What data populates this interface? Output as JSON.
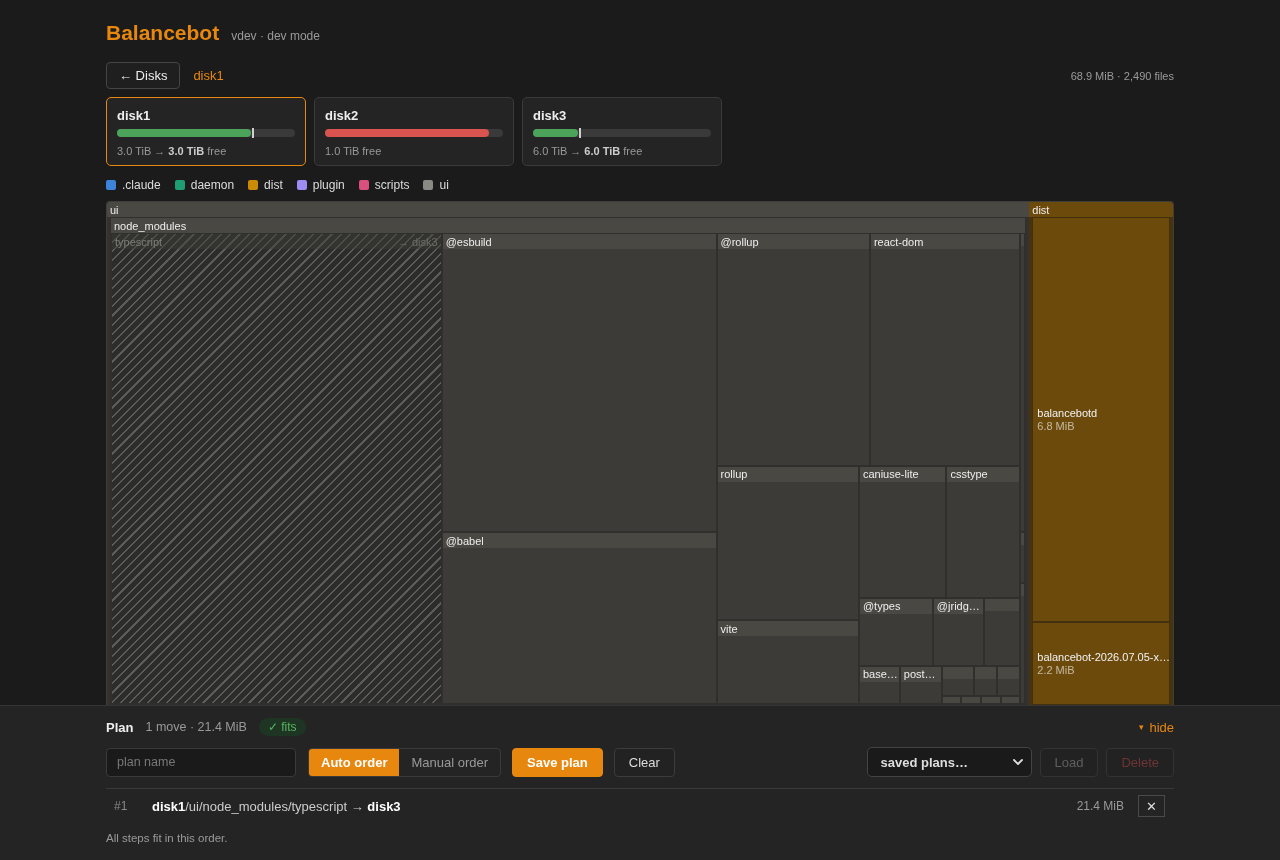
{
  "app": {
    "title": "Balancebot",
    "subtitle": "vdev · dev mode"
  },
  "nav": {
    "back_button": "← Disks",
    "current_disk": "disk1",
    "summary": "68.9 MiB · 2,490 files"
  },
  "disks": [
    {
      "name": "disk1",
      "selected": true,
      "level": 0.75,
      "color": "#4ca35a",
      "projection_marker": true,
      "free": "3.0 TiB → **3.0 TiB** free"
    },
    {
      "name": "disk2",
      "selected": false,
      "level": 0.92,
      "color": "#d9534f",
      "projection_marker": false,
      "free": "1.0 TiB free"
    },
    {
      "name": "disk3",
      "selected": false,
      "level": 0.25,
      "color": "#4ca35a",
      "projection_marker": true,
      "free": "6.0 TiB → **6.0 TiB** free"
    }
  ],
  "legend": [
    {
      "label": ".claude",
      "color": "#3b84d9"
    },
    {
      "label": "daemon",
      "color": "#1f9e74"
    },
    {
      "label": "dist",
      "color": "#c98a08"
    },
    {
      "label": "plugin",
      "color": "#9d8cf2"
    },
    {
      "label": "scripts",
      "color": "#d9507f"
    },
    {
      "label": "ui",
      "color": "#8a8a85"
    }
  ],
  "treemap": {
    "items": [
      {
        "name": "ui",
        "kind": "dir",
        "color": "#4a4843",
        "children": [
          {
            "name": "node_modules",
            "kind": "dir",
            "children": [
              {
                "name": "typescript",
                "kind": "dir",
                "moving": true,
                "target": "→ disk3"
              },
              {
                "name": "@esbuild",
                "kind": "dir",
                "moving": false
              },
              {
                "name": "@babel",
                "kind": "dir",
                "moving": false
              },
              {
                "name": "@rollup",
                "kind": "dir",
                "moving": false
              },
              {
                "name": "react-dom",
                "kind": "dir",
                "moving": false
              },
              {
                "name": "rollup",
                "kind": "dir",
                "moving": false
              },
              {
                "name": "vite",
                "kind": "dir",
                "moving": false
              },
              {
                "name": "caniuse-lite",
                "kind": "dir",
                "moving": false
              },
              {
                "name": "csstype",
                "kind": "dir",
                "moving": false
              },
              {
                "name": "@types",
                "kind": "dir",
                "moving": false
              },
              {
                "name": "@jridg…",
                "kind": "dir",
                "moving": false
              },
              {
                "name": "base…",
                "kind": "dir",
                "moving": false
              },
              {
                "name": "post…",
                "kind": "dir",
                "moving": false
              }
            ]
          }
        ]
      },
      {
        "name": "dist",
        "kind": "dir",
        "color": "#6b4a0c",
        "children": [
          {
            "name": "balancebotd",
            "kind": "file",
            "size": "6.8 MiB"
          },
          {
            "name": "balancebot-2026.07.05-x…",
            "kind": "file",
            "size": "2.2 MiB"
          }
        ]
      }
    ]
  },
  "plan": {
    "title": "Plan",
    "summary": "1 move · 21.4 MiB",
    "fits": true,
    "fit_badge": "✓ fits",
    "toggle": {
      "icon": "▾",
      "label": "hide"
    },
    "name_field": {
      "placeholder": "plan name"
    },
    "order_modes": [
      {
        "label": "Auto order",
        "selected": true
      },
      {
        "label": "Manual order",
        "selected": false
      }
    ],
    "buttons": [
      {
        "label": "Save plan",
        "kind": "primary"
      },
      {
        "label": "Clear",
        "kind": "secondary"
      }
    ],
    "saved_plans": {
      "value": "saved plans…"
    },
    "saved_actions": [
      {
        "label": "Load",
        "kind": "secondary",
        "disabled": true
      },
      {
        "label": "Delete",
        "kind": "danger",
        "disabled": true
      }
    ],
    "steps": [
      {
        "number": "#1",
        "path": "**disk1**/ui/node_modules/typescript → **disk3**",
        "size": "21.4 MiB",
        "remove": "✕"
      }
    ],
    "footer": "All steps fit in this order."
  }
}
